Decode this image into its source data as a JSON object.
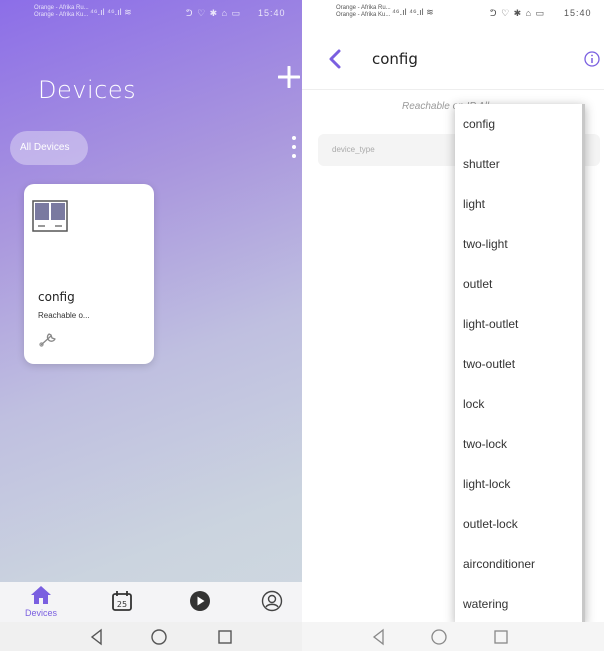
{
  "left": {
    "status_bar": {
      "carrier_line1": "Orange - Afrika Ru...",
      "carrier_line2": "Orange - Afrika Ku...",
      "signal": "⁴⁶.ıl ⁴⁶.ıl ≋",
      "right_icons": "ᕤ ♡ ✱ ⌂ ▭",
      "time": "15:40"
    },
    "page_title": "Devices",
    "filter_chip": "All Devices",
    "device_card": {
      "name": "config",
      "status": "Reachable o..."
    },
    "bottom_nav": {
      "devices_label": "Devices",
      "calendar_day": "25"
    }
  },
  "right": {
    "status_bar": {
      "carrier_line1": "Orange - Afrika Ru...",
      "carrier_line2": "Orange - Afrika Ku...",
      "signal": "⁴⁶.ıl ⁴⁶.ıl ≋",
      "right_icons": "ᕤ ♡ ✱ ⌂ ▭",
      "time": "15:40"
    },
    "header_title": "config",
    "reachable_text": "Reachable on IP All",
    "field_label": "device_type",
    "dropdown_options": [
      "config",
      "shutter",
      "light",
      "two-light",
      "outlet",
      "light-outlet",
      "two-outlet",
      "lock",
      "two-lock",
      "light-lock",
      "outlet-lock",
      "airconditioner",
      "watering"
    ]
  },
  "colors": {
    "accent": "#7a5fe0",
    "gradient_top": "#8c6ee8",
    "gradient_bottom": "#d0d9e0"
  }
}
